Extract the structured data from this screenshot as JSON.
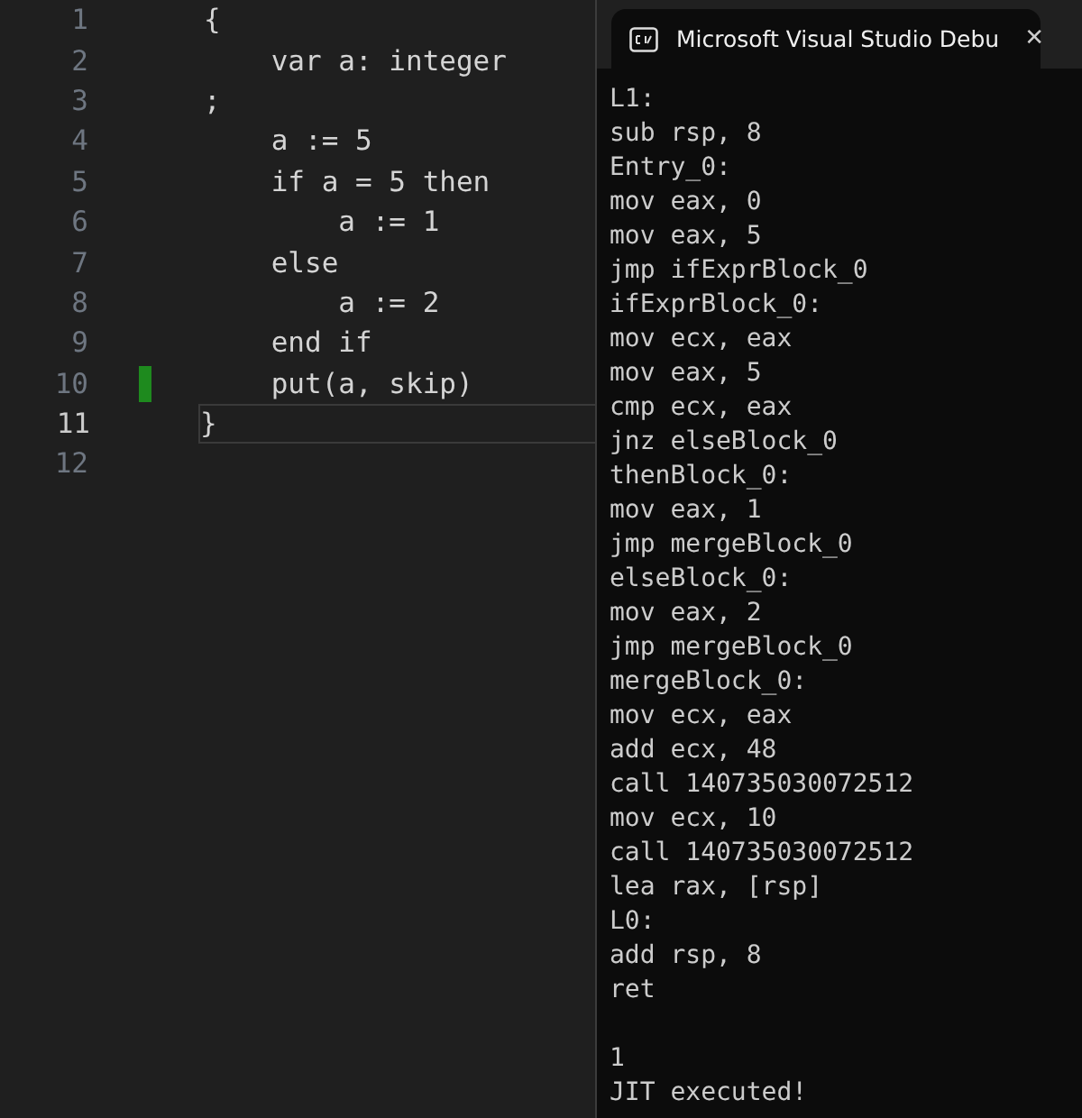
{
  "editor": {
    "lines": [
      {
        "number": "1",
        "text": "{",
        "modified": false,
        "current": false
      },
      {
        "number": "2",
        "text": "    var a: integer",
        "modified": false,
        "current": false
      },
      {
        "number": "3",
        "text": ";",
        "modified": false,
        "current": false
      },
      {
        "number": "4",
        "text": "    a := 5",
        "modified": false,
        "current": false
      },
      {
        "number": "5",
        "text": "    if a = 5 then",
        "modified": false,
        "current": false
      },
      {
        "number": "6",
        "text": "        a := 1",
        "modified": false,
        "current": false
      },
      {
        "number": "7",
        "text": "    else",
        "modified": false,
        "current": false
      },
      {
        "number": "8",
        "text": "        a := 2",
        "modified": false,
        "current": false
      },
      {
        "number": "9",
        "text": "    end if",
        "modified": false,
        "current": false
      },
      {
        "number": "10",
        "text": "    put(a, skip)",
        "modified": true,
        "current": false
      },
      {
        "number": "11",
        "text": "}",
        "modified": false,
        "current": true
      },
      {
        "number": "12",
        "modified": false,
        "current": false
      }
    ]
  },
  "terminal": {
    "tab_title": "Microsoft Visual Studio Debu",
    "close": "✕",
    "listing": [
      "L1:",
      "sub rsp, 8",
      "Entry_0:",
      "mov eax, 0",
      "mov eax, 5",
      "jmp ifExprBlock_0",
      "ifExprBlock_0:",
      "mov ecx, eax",
      "mov eax, 5",
      "cmp ecx, eax",
      "jnz elseBlock_0",
      "thenBlock_0:",
      "mov eax, 1",
      "jmp mergeBlock_0",
      "elseBlock_0:",
      "mov eax, 2",
      "jmp mergeBlock_0",
      "mergeBlock_0:",
      "mov ecx, eax",
      "add ecx, 48",
      "call 140735030072512",
      "mov ecx, 10",
      "call 140735030072512",
      "lea rax, [rsp]",
      "L0:",
      "add rsp, 8",
      "ret"
    ],
    "output": [
      "1",
      "JIT executed!"
    ]
  }
}
